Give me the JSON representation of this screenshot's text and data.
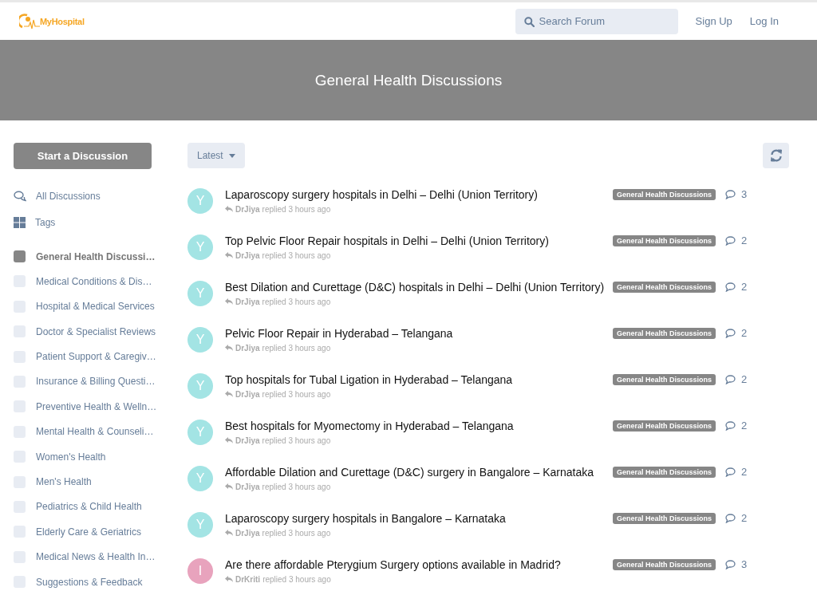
{
  "header": {
    "logo": "MyHospital",
    "search": {
      "placeholder": "Search Forum"
    },
    "links": [
      "Sign Up",
      "Log In"
    ]
  },
  "hero": {
    "title": "General Health Discussions"
  },
  "sidebar": {
    "start_button": "Start a Discussion",
    "nav": [
      {
        "label": "All Discussions",
        "kind": "discussions"
      },
      {
        "label": "Tags",
        "kind": "tags"
      }
    ],
    "categories": [
      {
        "label": "General Health Discussi…",
        "selected": true
      },
      {
        "label": "Medical Conditions & Dis…",
        "selected": false
      },
      {
        "label": "Hospital & Medical Services",
        "selected": false
      },
      {
        "label": "Doctor & Specialist Reviews",
        "selected": false
      },
      {
        "label": "Patient Support & Caregiv…",
        "selected": false
      },
      {
        "label": "Insurance & Billing Questi…",
        "selected": false
      },
      {
        "label": "Preventive Health & Welln…",
        "selected": false
      },
      {
        "label": "Mental Health & Counseli…",
        "selected": false
      },
      {
        "label": "Women's Health",
        "selected": false
      },
      {
        "label": "Men's Health",
        "selected": false
      },
      {
        "label": "Pediatrics & Child Health",
        "selected": false
      },
      {
        "label": "Elderly Care & Geriatrics",
        "selected": false
      },
      {
        "label": "Medical News & Health In…",
        "selected": false
      },
      {
        "label": "Suggestions & Feedback",
        "selected": false
      }
    ]
  },
  "toolbar": {
    "sort": "Latest"
  },
  "discussions": [
    {
      "avatar": "Y",
      "color": "#a3e4e4",
      "title": "Laparoscopy surgery hospitals in Delhi – Delhi (Union Territory)",
      "user": "DrJiya",
      "meta": "replied 3 hours ago",
      "tag": "General Health Discussions",
      "replies": "3"
    },
    {
      "avatar": "Y",
      "color": "#a3e4e4",
      "title": "Top Pelvic Floor Repair hospitals in Delhi – Delhi (Union Territory)",
      "user": "DrJiya",
      "meta": "replied 3 hours ago",
      "tag": "General Health Discussions",
      "replies": "2"
    },
    {
      "avatar": "Y",
      "color": "#a3e4e4",
      "title": "Best Dilation and Curettage (D&C) hospitals in Delhi – Delhi (Union Territory)",
      "user": "DrJiya",
      "meta": "replied 3 hours ago",
      "tag": "General Health Discussions",
      "replies": "2"
    },
    {
      "avatar": "Y",
      "color": "#a3e4e4",
      "title": "Pelvic Floor Repair in Hyderabad – Telangana",
      "user": "DrJiya",
      "meta": "replied 3 hours ago",
      "tag": "General Health Discussions",
      "replies": "2"
    },
    {
      "avatar": "Y",
      "color": "#a3e4e4",
      "title": "Top hospitals for Tubal Ligation in Hyderabad – Telangana",
      "user": "DrJiya",
      "meta": "replied 3 hours ago",
      "tag": "General Health Discussions",
      "replies": "2"
    },
    {
      "avatar": "Y",
      "color": "#a3e4e4",
      "title": "Best hospitals for Myomectomy in Hyderabad – Telangana",
      "user": "DrJiya",
      "meta": "replied 3 hours ago",
      "tag": "General Health Discussions",
      "replies": "2"
    },
    {
      "avatar": "Y",
      "color": "#a3e4e4",
      "title": "Affordable Dilation and Curettage (D&C) surgery in Bangalore – Karnataka",
      "user": "DrJiya",
      "meta": "replied 3 hours ago",
      "tag": "General Health Discussions",
      "replies": "2"
    },
    {
      "avatar": "Y",
      "color": "#a3e4e4",
      "title": "Laparoscopy surgery hospitals in Bangalore – Karnataka",
      "user": "DrJiya",
      "meta": "replied 3 hours ago",
      "tag": "General Health Discussions",
      "replies": "2"
    },
    {
      "avatar": "I",
      "color": "#e8a3bd",
      "title": "Are there affordable Pterygium Surgery options available in Madrid?",
      "user": "DrKriti",
      "meta": "replied 3 hours ago",
      "tag": "General Health Discussions",
      "replies": "3"
    }
  ]
}
